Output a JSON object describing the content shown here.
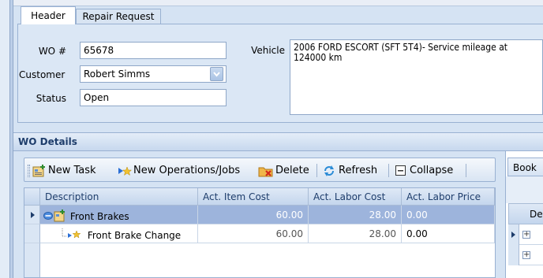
{
  "tabs": [
    {
      "label": "Header",
      "active": true
    },
    {
      "label": "Repair Request",
      "active": false
    }
  ],
  "header_form": {
    "wo_label": "WO #",
    "wo_value": "65678",
    "customer_label": "Customer",
    "customer_value": "Robert Simms",
    "status_label": "Status",
    "status_value": "Open",
    "vehicle_label": "Vehicle",
    "vehicle_value": "2006 FORD ESCORT (SFT 5T4)- Service mileage at 124000 km"
  },
  "wo_details": {
    "title": "WO Details",
    "toolbar": {
      "new_task": "New Task",
      "new_operations": "New Operations/Jobs",
      "delete": "Delete",
      "refresh": "Refresh",
      "collapse": "Collapse"
    },
    "columns": [
      "Description",
      "Act. Item Cost",
      "Act. Labor Cost",
      "Act. Labor Price"
    ],
    "rows": [
      {
        "description": "Front Brakes",
        "item_cost": "60.00",
        "labor_cost": "28.00",
        "labor_price": "0.00",
        "selected": true
      },
      {
        "description": "Front Brake Change",
        "item_cost": "60.00",
        "labor_cost": "28.00",
        "labor_price": "0.00",
        "selected": false
      }
    ]
  },
  "right_panel": {
    "tab_label": "Book",
    "column_header": "De"
  },
  "icons": {
    "new_task": "task-add-icon",
    "new_operations": "arrow-star-icon",
    "delete": "folder-delete-icon",
    "refresh": "refresh-icon",
    "collapse": "collapse-icon",
    "row_indicator": "triangle-right-icon",
    "expander_minus": "minus-box-icon",
    "expander_plus": "plus-box-icon"
  },
  "colors": {
    "accent": "#1e3d6b",
    "selected_row": "#9db4dc",
    "panel_bg": "#dbe7f5"
  }
}
